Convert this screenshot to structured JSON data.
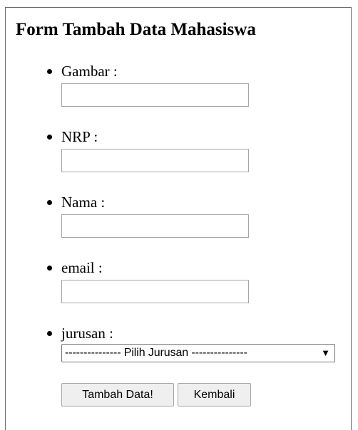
{
  "page": {
    "title": "Form Tambah Data Mahasiswa"
  },
  "form": {
    "fields": [
      {
        "label": "Gambar :",
        "value": ""
      },
      {
        "label": "NRP :",
        "value": ""
      },
      {
        "label": "Nama :",
        "value": ""
      },
      {
        "label": "email :",
        "value": ""
      },
      {
        "label": "jurusan :",
        "selected": "--------------- Pilih Jurusan ---------------"
      }
    ],
    "select_arrow": "▼",
    "submit_label": "Tambah Data!",
    "back_label": "Kembali"
  },
  "colors": {
    "frame_border": "#5a6f96",
    "input_border": "#a6a6a6",
    "button_bg": "#efefef"
  }
}
